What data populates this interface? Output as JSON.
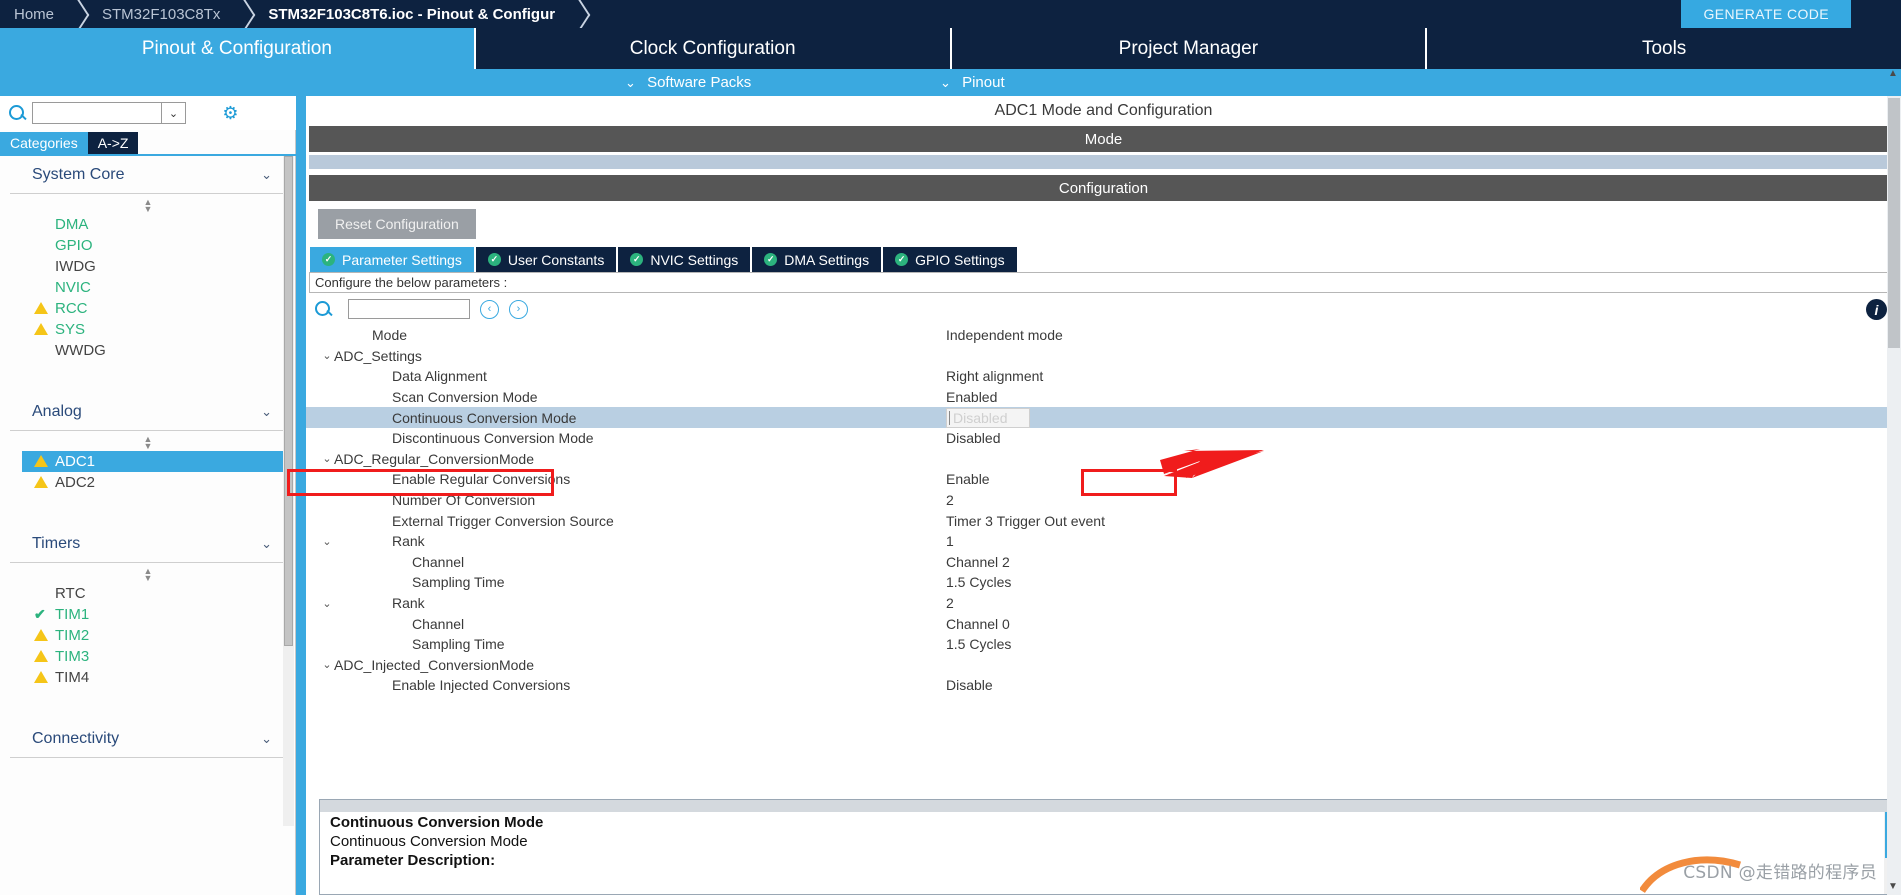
{
  "breadcrumb": {
    "home": "Home",
    "device": "STM32F103C8Tx",
    "file": "STM32F103C8T6.ioc - Pinout & Configur"
  },
  "titlebar": {
    "generate_code": "GENERATE CODE"
  },
  "main_tabs": [
    {
      "label": "Pinout & Configuration",
      "active": true
    },
    {
      "label": "Clock Configuration",
      "active": false
    },
    {
      "label": "Project Manager",
      "active": false
    },
    {
      "label": "Tools",
      "active": false
    }
  ],
  "sub_strip": {
    "software_packs": "Software Packs",
    "pinout": "Pinout",
    "chevron": "⌄"
  },
  "sidebar": {
    "search": {
      "value": "",
      "placeholder": "",
      "icon": "search-icon",
      "dropdown_caret": "⌄"
    },
    "gear_icon": "gear-icon",
    "view_tabs": [
      {
        "label": "Categories",
        "active": true
      },
      {
        "label": "A->Z",
        "active": false
      }
    ],
    "groups": [
      {
        "name": "System Core",
        "caret": "⌄",
        "items": [
          {
            "label": "DMA",
            "status": "none",
            "color": "green"
          },
          {
            "label": "GPIO",
            "status": "none",
            "color": "green"
          },
          {
            "label": "IWDG",
            "status": "none",
            "color": "dark"
          },
          {
            "label": "NVIC",
            "status": "none",
            "color": "green"
          },
          {
            "label": "RCC",
            "status": "warning",
            "color": "green"
          },
          {
            "label": "SYS",
            "status": "warning",
            "color": "green"
          },
          {
            "label": "WWDG",
            "status": "none",
            "color": "dark"
          }
        ]
      },
      {
        "name": "Analog",
        "caret": "⌄",
        "items": [
          {
            "label": "ADC1",
            "status": "warning",
            "color": "dark",
            "selected": true
          },
          {
            "label": "ADC2",
            "status": "warning",
            "color": "dark"
          }
        ]
      },
      {
        "name": "Timers",
        "caret": "⌄",
        "items": [
          {
            "label": "RTC",
            "status": "none",
            "color": "dark"
          },
          {
            "label": "TIM1",
            "status": "check",
            "color": "green"
          },
          {
            "label": "TIM2",
            "status": "warning",
            "color": "green"
          },
          {
            "label": "TIM3",
            "status": "warning",
            "color": "green"
          },
          {
            "label": "TIM4",
            "status": "warning",
            "color": "dark"
          }
        ]
      },
      {
        "name": "Connectivity",
        "caret": "⌄",
        "items": []
      }
    ]
  },
  "content": {
    "title": "ADC1 Mode and Configuration",
    "mode_bar": "Mode",
    "configuration_bar": "Configuration",
    "reset_button": "Reset Configuration",
    "sub_tabs": [
      {
        "label": "Parameter Settings",
        "active": true,
        "icon": "check-circle-icon"
      },
      {
        "label": "User Constants",
        "active": false,
        "icon": "check-circle-icon"
      },
      {
        "label": "NVIC Settings",
        "active": false,
        "icon": "check-circle-icon"
      },
      {
        "label": "DMA Settings",
        "active": false,
        "icon": "check-circle-icon"
      },
      {
        "label": "GPIO Settings",
        "active": false,
        "icon": "check-circle-icon"
      }
    ],
    "configure_note": "Configure the below parameters :",
    "param_search": {
      "value": "",
      "placeholder": "",
      "icon": "search-icon"
    },
    "nav_prev_icon": "‹",
    "nav_next_icon": "›",
    "info_icon": "i",
    "parameters": [
      {
        "name": "Mode",
        "value": "Independent mode",
        "indent": 1,
        "twisty": ""
      },
      {
        "name": "ADC_Settings",
        "value": "",
        "indent": 0,
        "twisty": "⌄"
      },
      {
        "name": "Data Alignment",
        "value": "Right alignment",
        "indent": 2,
        "twisty": ""
      },
      {
        "name": "Scan Conversion Mode",
        "value": "Enabled",
        "indent": 2,
        "twisty": ""
      },
      {
        "name": "Continuous Conversion Mode",
        "value": "Disabled",
        "indent": 2,
        "twisty": "",
        "selected": true,
        "editing": true
      },
      {
        "name": "Discontinuous Conversion Mode",
        "value": "Disabled",
        "indent": 2,
        "twisty": ""
      },
      {
        "name": "ADC_Regular_ConversionMode",
        "value": "",
        "indent": 0,
        "twisty": "⌄"
      },
      {
        "name": "Enable Regular Conversions",
        "value": "Enable",
        "indent": 2,
        "twisty": ""
      },
      {
        "name": "Number Of Conversion",
        "value": "2",
        "indent": 2,
        "twisty": ""
      },
      {
        "name": "External Trigger Conversion Source",
        "value": "Timer 3 Trigger Out event",
        "indent": 2,
        "twisty": ""
      },
      {
        "name": "Rank",
        "value": "1",
        "indent": 2,
        "twisty": "⌄"
      },
      {
        "name": "Channel",
        "value": "Channel 2",
        "indent": 3,
        "twisty": ""
      },
      {
        "name": "Sampling Time",
        "value": "1.5 Cycles",
        "indent": 3,
        "twisty": ""
      },
      {
        "name": "Rank",
        "value": "2",
        "indent": 2,
        "twisty": "⌄"
      },
      {
        "name": "Channel",
        "value": "Channel 0",
        "indent": 3,
        "twisty": ""
      },
      {
        "name": "Sampling Time",
        "value": "1.5 Cycles",
        "indent": 3,
        "twisty": ""
      },
      {
        "name": "ADC_Injected_ConversionMode",
        "value": "",
        "indent": 0,
        "twisty": "⌄"
      },
      {
        "name": "Enable Injected Conversions",
        "value": "Disable",
        "indent": 2,
        "twisty": ""
      }
    ]
  },
  "description_panel": {
    "title": "Continuous Conversion Mode",
    "subtitle": "Continuous Conversion Mode",
    "label": "Parameter Description:"
  },
  "watermark": "CSDN @走错路的程序员",
  "colors": {
    "accent_blue": "#3aa9e0",
    "navy": "#0d2240",
    "warn_yellow": "#f5c518",
    "ok_green": "#2cb37e",
    "annotation_red": "#f01c1c",
    "selection_blue": "#b9cfe2"
  }
}
